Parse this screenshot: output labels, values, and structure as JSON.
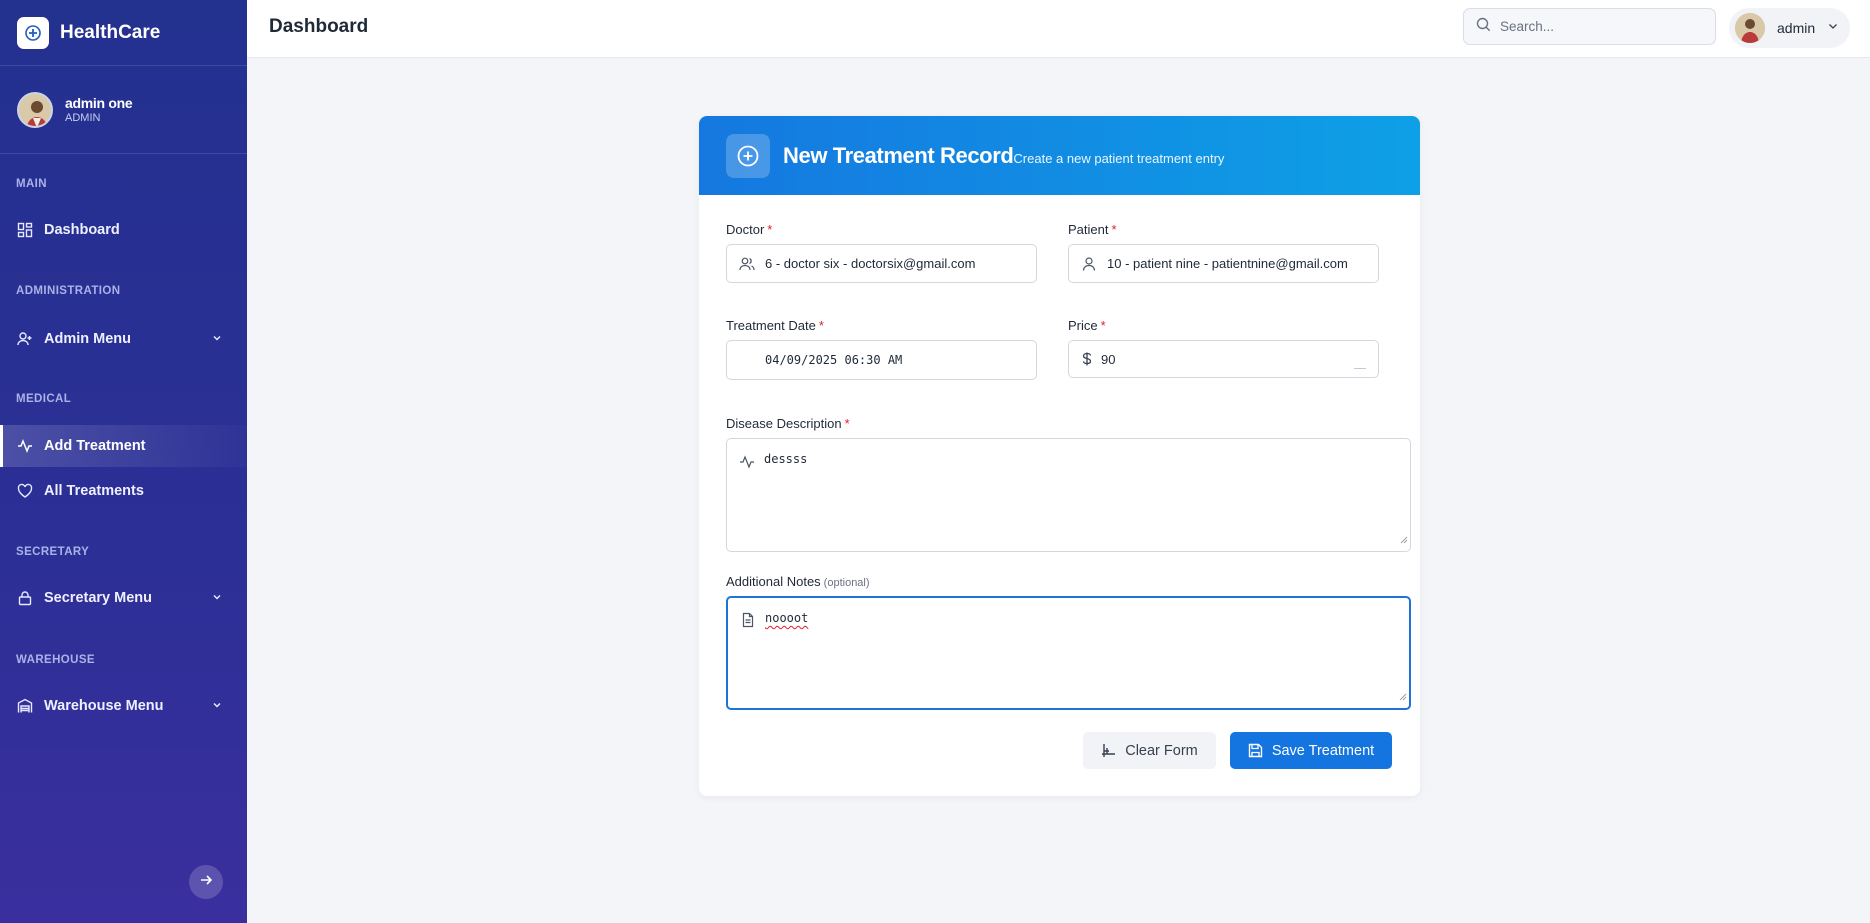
{
  "sidebar": {
    "brand": "HealthCare",
    "profile": {
      "name": "admin one",
      "role": "ADMIN"
    },
    "sections": {
      "main": "MAIN",
      "administration": "ADMINISTRATION",
      "medical": "MEDICAL",
      "secretary": "SECRETARY",
      "warehouse": "WAREHOUSE"
    },
    "items": {
      "dashboard": "Dashboard",
      "admin_menu": "Admin Menu",
      "add_treatment": "Add Treatment",
      "all_treatments": "All Treatments",
      "secretary_menu": "Secretary Menu",
      "warehouse_menu": "Warehouse Menu"
    }
  },
  "topbar": {
    "title": "Dashboard",
    "search_placeholder": "Search...",
    "user": "admin"
  },
  "form": {
    "title": "New Treatment Record",
    "subtitle": "Create a new patient treatment entry",
    "doctor_label": "Doctor",
    "doctor_value": "6 - doctor six - doctorsix@gmail.com",
    "patient_label": "Patient",
    "patient_value": "10 - patient nine - patientnine@gmail.com",
    "date_label": "Treatment Date",
    "date_value": "04/09/2025 06:30 AM",
    "price_label": "Price",
    "price_value": "90",
    "description_label": "Disease Description",
    "description_value": "dessss",
    "notes_label": "Additional Notes",
    "notes_optional": "(optional)",
    "notes_value": "noooot",
    "required_mark": "*",
    "clear_button": "Clear Form",
    "save_button": "Save Treatment"
  },
  "colors": {
    "sidebar_bg": "#2a3192",
    "header_gradient_start": "#1578e0",
    "header_gradient_end": "#0ea0e6",
    "primary_button": "#1474e0",
    "required": "#e11d2a"
  }
}
